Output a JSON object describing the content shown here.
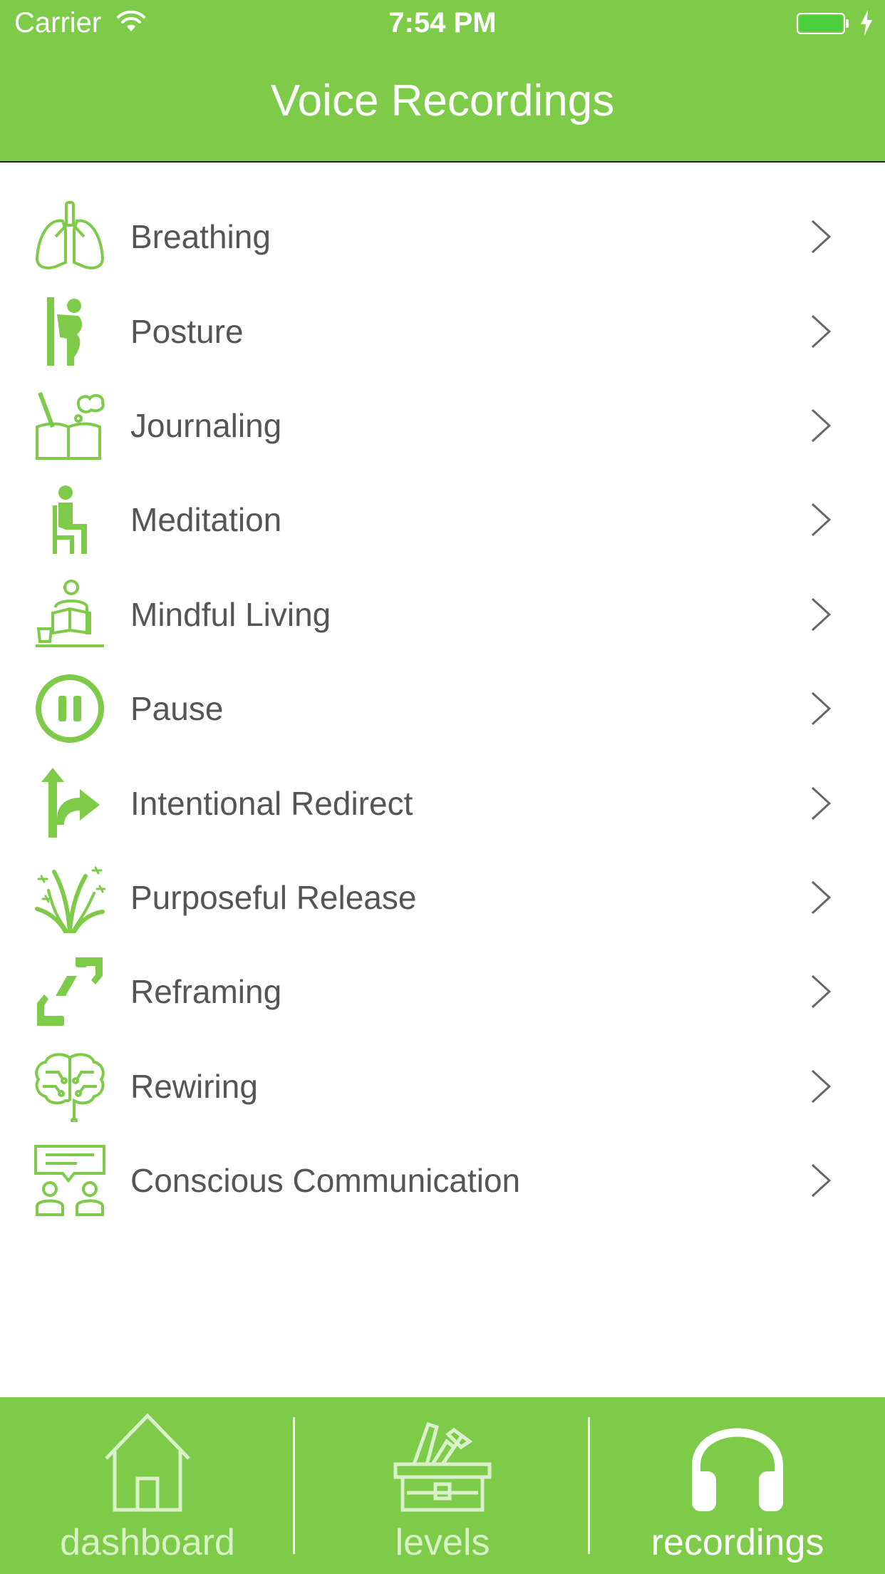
{
  "status_bar": {
    "carrier": "Carrier",
    "time": "7:54 PM"
  },
  "header": {
    "title": "Voice Recordings"
  },
  "items": [
    {
      "label": "Breathing",
      "icon": "lungs-icon"
    },
    {
      "label": "Posture",
      "icon": "posture-icon"
    },
    {
      "label": "Journaling",
      "icon": "journal-icon"
    },
    {
      "label": "Meditation",
      "icon": "meditation-icon"
    },
    {
      "label": "Mindful Living",
      "icon": "mindful-living-icon"
    },
    {
      "label": "Pause",
      "icon": "pause-icon"
    },
    {
      "label": "Intentional Redirect",
      "icon": "redirect-arrow-icon"
    },
    {
      "label": "Purposeful Release",
      "icon": "release-burst-icon"
    },
    {
      "label": "Reframing",
      "icon": "frame-hands-icon"
    },
    {
      "label": "Rewiring",
      "icon": "brain-circuit-icon"
    },
    {
      "label": "Conscious Communication",
      "icon": "conversation-icon"
    }
  ],
  "tabs": [
    {
      "label": "dashboard",
      "icon": "house-icon",
      "active": false
    },
    {
      "label": "levels",
      "icon": "toolbox-icon",
      "active": false
    },
    {
      "label": "recordings",
      "icon": "headphones-icon",
      "active": true
    }
  ],
  "colors": {
    "brand_green": "#7ecb4a",
    "text": "#555555",
    "chevron": "#666666"
  }
}
